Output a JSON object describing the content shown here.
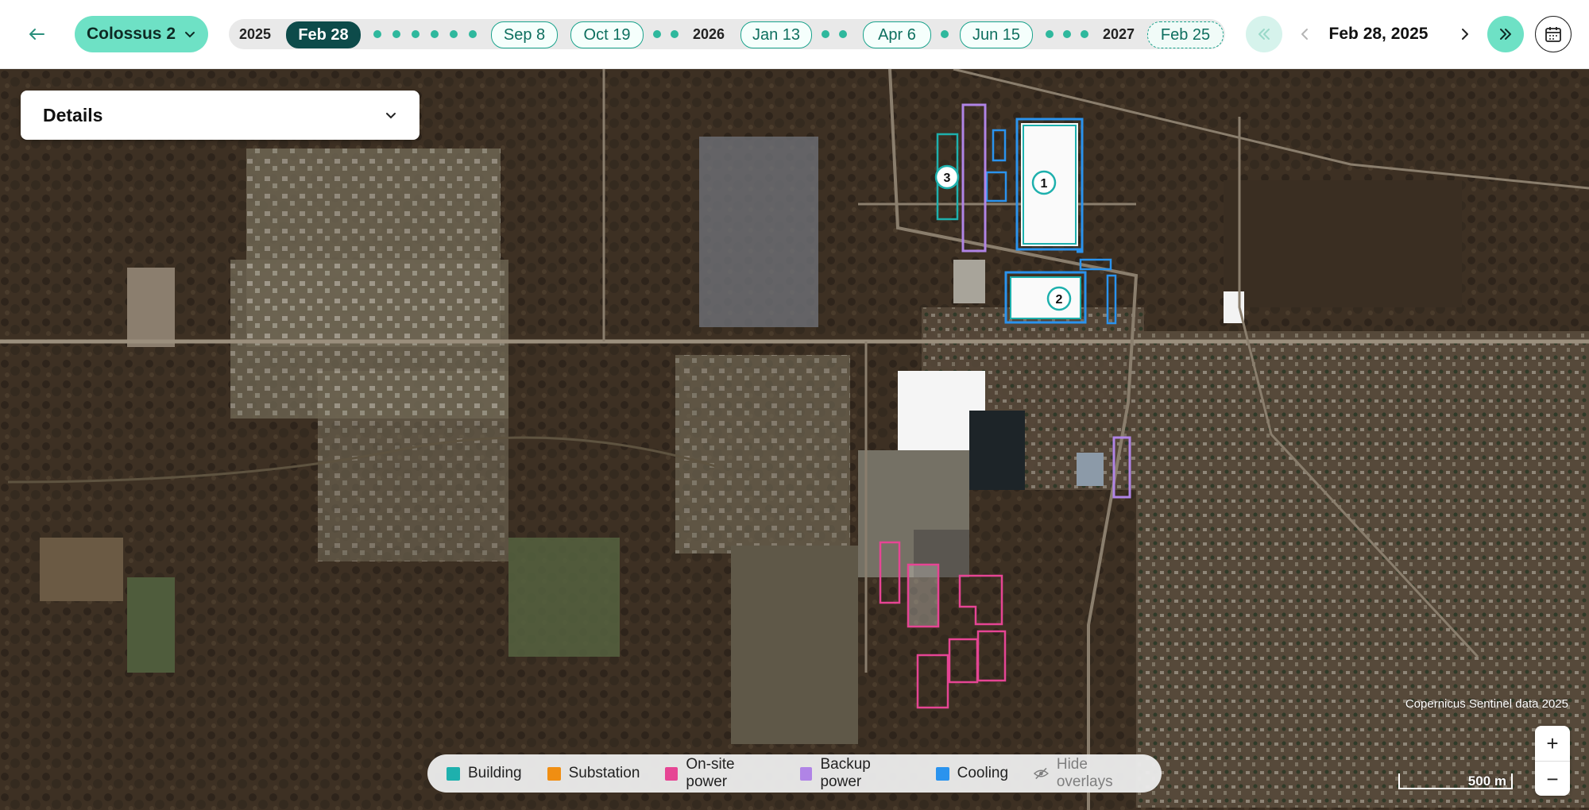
{
  "site": {
    "name": "Colossus 2"
  },
  "timeline": {
    "years": [
      "2025",
      "2026",
      "2027"
    ],
    "dates": [
      "Feb 28",
      "Sep 8",
      "Oct 19",
      "Jan 13",
      "Apr 6",
      "Jun 15",
      "Feb 25"
    ],
    "active": "Feb 28"
  },
  "current_date": "Feb 28, 2025",
  "details": {
    "label": "Details"
  },
  "legend": {
    "items": [
      {
        "label": "Building",
        "color": "#1eb0ad"
      },
      {
        "label": "Substation",
        "color": "#f08e12"
      },
      {
        "label": "On-site power",
        "color": "#e64594"
      },
      {
        "label": "Backup power",
        "color": "#b084e6"
      },
      {
        "label": "Cooling",
        "color": "#2a93ee"
      }
    ],
    "hide_label": "Hide overlays"
  },
  "overlay_markers": [
    "1",
    "2",
    "3"
  ],
  "attribution": "Copernicus Sentinel data 2025",
  "scale": "500 m",
  "zoom": {
    "in": "+",
    "out": "−"
  },
  "colors": {
    "accent": "#6ee1c5",
    "active_pill": "#0d4b4a",
    "building": "#1eb0ad",
    "cooling": "#2a93ee",
    "onsite_power": "#e64594",
    "backup_power": "#b084e6"
  }
}
